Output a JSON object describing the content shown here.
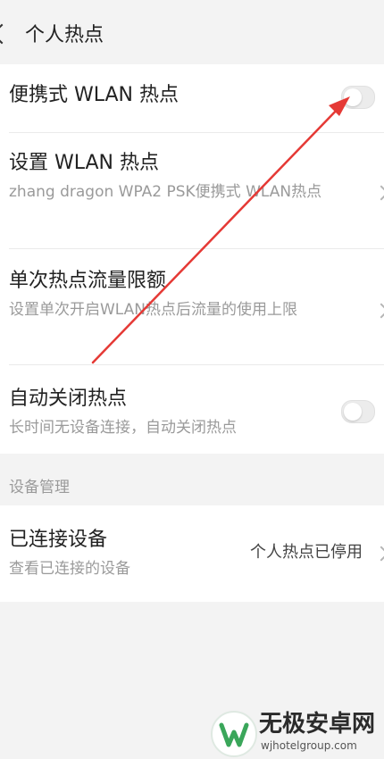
{
  "header": {
    "title": "个人热点"
  },
  "settings": {
    "portable_hotspot": {
      "title": "便携式 WLAN 热点",
      "enabled": false
    },
    "setup_hotspot": {
      "title": "设置 WLAN 热点",
      "subtitle": "zhang dragon WPA2 PSK便携式 WLAN热点"
    },
    "data_limit": {
      "title": "单次热点流量限额",
      "subtitle": "设置单次开启WLAN热点后流量的使用上限"
    },
    "auto_close": {
      "title": "自动关闭热点",
      "subtitle": "长时间无设备连接，自动关闭热点",
      "enabled": false
    }
  },
  "device_management": {
    "section_title": "设备管理",
    "connected_devices": {
      "title": "已连接设备",
      "subtitle": "查看已连接的设备",
      "value": "个人热点已停用"
    }
  },
  "annotation": {
    "arrow_color": "#e53935"
  },
  "watermark": {
    "title": "无极安卓网",
    "url": "wjhotelgroup.com",
    "logo_color": "#3aa65a"
  }
}
